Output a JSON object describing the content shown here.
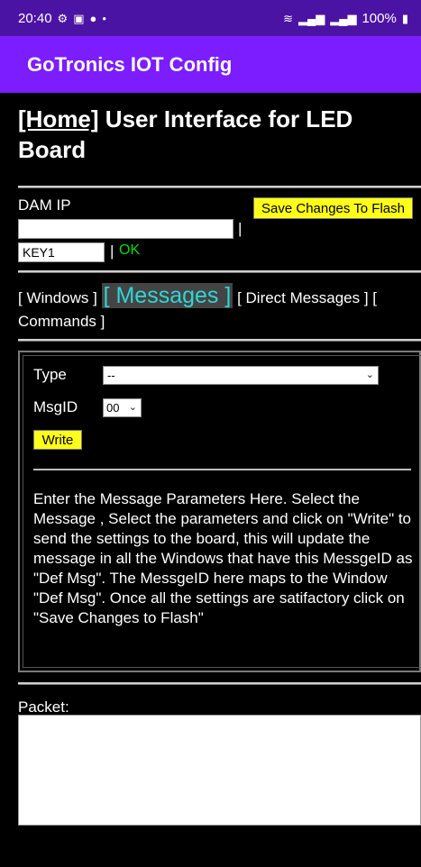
{
  "status_bar": {
    "time": "20:40",
    "battery": "100%",
    "icons_left": [
      "gear-icon",
      "image-icon",
      "bag-icon",
      "dot-icon"
    ],
    "icons_right": [
      "wifi-icon",
      "signal-icon",
      "signal-icon"
    ]
  },
  "app_bar": {
    "title": "GoTronics IOT Config"
  },
  "heading": {
    "home_link": "[Home]",
    "title": " User Interface for LED Board"
  },
  "dam": {
    "label": "DAM IP",
    "ip_value": "",
    "separator": "|",
    "save_label": "Save Changes To Flash",
    "key_value": "KEY1",
    "key_separator": "|",
    "ok_label": "OK"
  },
  "tabs": [
    {
      "label": "[ Windows ]"
    },
    {
      "label": "[ Messages ]",
      "active": true
    },
    {
      "label": "[ Direct Messages ]"
    },
    {
      "label": "[ Commands ]"
    }
  ],
  "form": {
    "type_label": "Type",
    "type_value": "--",
    "msgid_label": "MsgID",
    "msgid_value": "00",
    "write_label": "Write",
    "description": "Enter the Message Parameters Here. Select the Message , Select the parameters and click on \"Write\" to send the settings to the board, this will update the message in all the Windows that have this MessgeID as \"Def Msg\". The MessgeID here maps to the Window \"Def Msg\". Once all the settings are satifactory click on \"Save Changes to Flash\""
  },
  "packet": {
    "label": "Packet:",
    "value": ""
  },
  "colors": {
    "app_bar": "#7b1dff",
    "status_bar": "#4b13a3",
    "button": "#ffff1a",
    "active_tab": "#2fd6d6",
    "ok": "#00dd00"
  }
}
